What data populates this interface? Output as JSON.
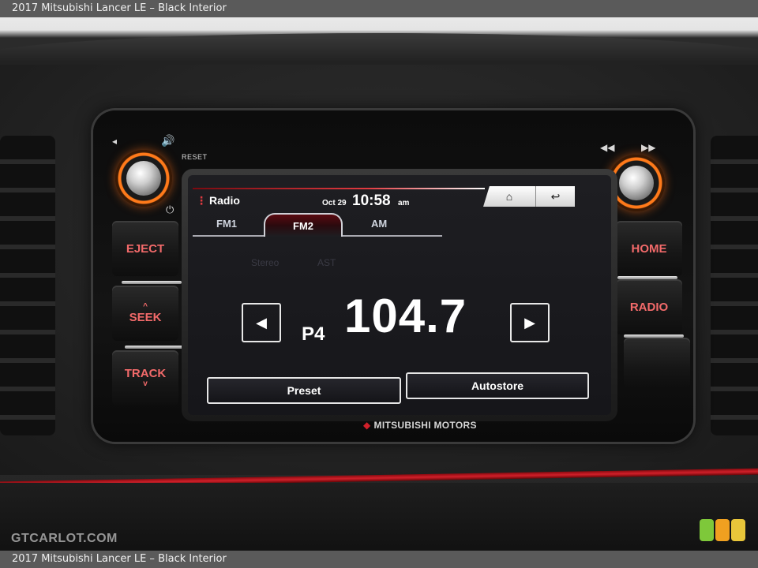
{
  "caption": {
    "top": "2017 Mitsubishi Lancer LE – Black Interior",
    "bottom": "2017 Mitsubishi Lancer LE – Black Interior"
  },
  "head_unit": {
    "reset_label": "RESET",
    "brand": "MITSUBISHI MOTORS",
    "buttons_left": {
      "eject": "EJECT",
      "seek": "SEEK",
      "track": "TRACK"
    },
    "buttons_right": {
      "home": "HOME",
      "radio": "RADIO"
    },
    "icons": {
      "volume_down": "◂",
      "volume_up": "🔊",
      "power": "⏻",
      "rewind": "◀◀",
      "fast_forward": "▶▶",
      "seek_up": "^",
      "track_down": "v"
    }
  },
  "screen": {
    "title": "Radio",
    "date": "Oct 29",
    "time": "10:58",
    "ampm": "am",
    "tabs": [
      {
        "label": "FM1",
        "selected": false
      },
      {
        "label": "FM2",
        "selected": true
      },
      {
        "label": "AM",
        "selected": false
      }
    ],
    "ghost": {
      "stereo": "Stereo",
      "ast": "AST"
    },
    "preset_number": "P4",
    "frequency": "104.7",
    "prev_symbol": "◀",
    "next_symbol": "▶",
    "home_symbol": "⌂",
    "back_symbol": "↩",
    "preset_label": "Preset",
    "autostore_label": "Autostore"
  },
  "watermark": "GTCARLOT.COM",
  "colors": {
    "accent_red": "#e03a40",
    "knob_orange": "#ff7a1a",
    "button_text": "#f26a6a"
  }
}
